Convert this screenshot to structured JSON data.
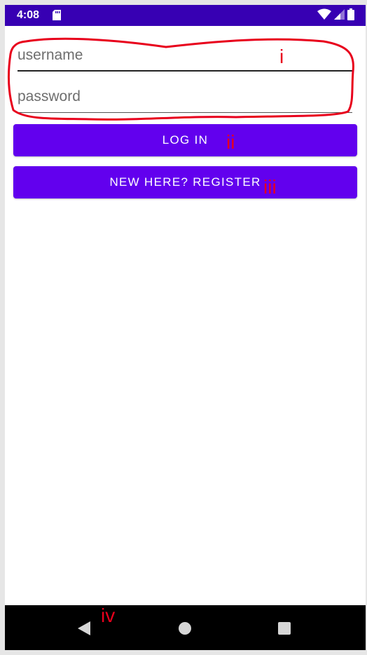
{
  "status_bar": {
    "time": "4:08",
    "icons": [
      "sd-card-icon",
      "wifi-icon",
      "signal-icon",
      "battery-icon"
    ]
  },
  "login_form": {
    "username": {
      "placeholder": "username",
      "value": ""
    },
    "password": {
      "placeholder": "password",
      "value": ""
    },
    "login_label": "LOG IN",
    "register_label": "NEW HERE? REGISTER"
  },
  "annotations": {
    "fields": "i",
    "login": "ii",
    "register": "iii",
    "nav": "iv"
  },
  "nav_bar": {
    "buttons": [
      "back-icon",
      "home-icon",
      "recents-icon"
    ]
  },
  "colors": {
    "status_bar": "#3700b3",
    "primary": "#6200ee",
    "annotation": "#e8001c",
    "nav_bar": "#000000"
  }
}
